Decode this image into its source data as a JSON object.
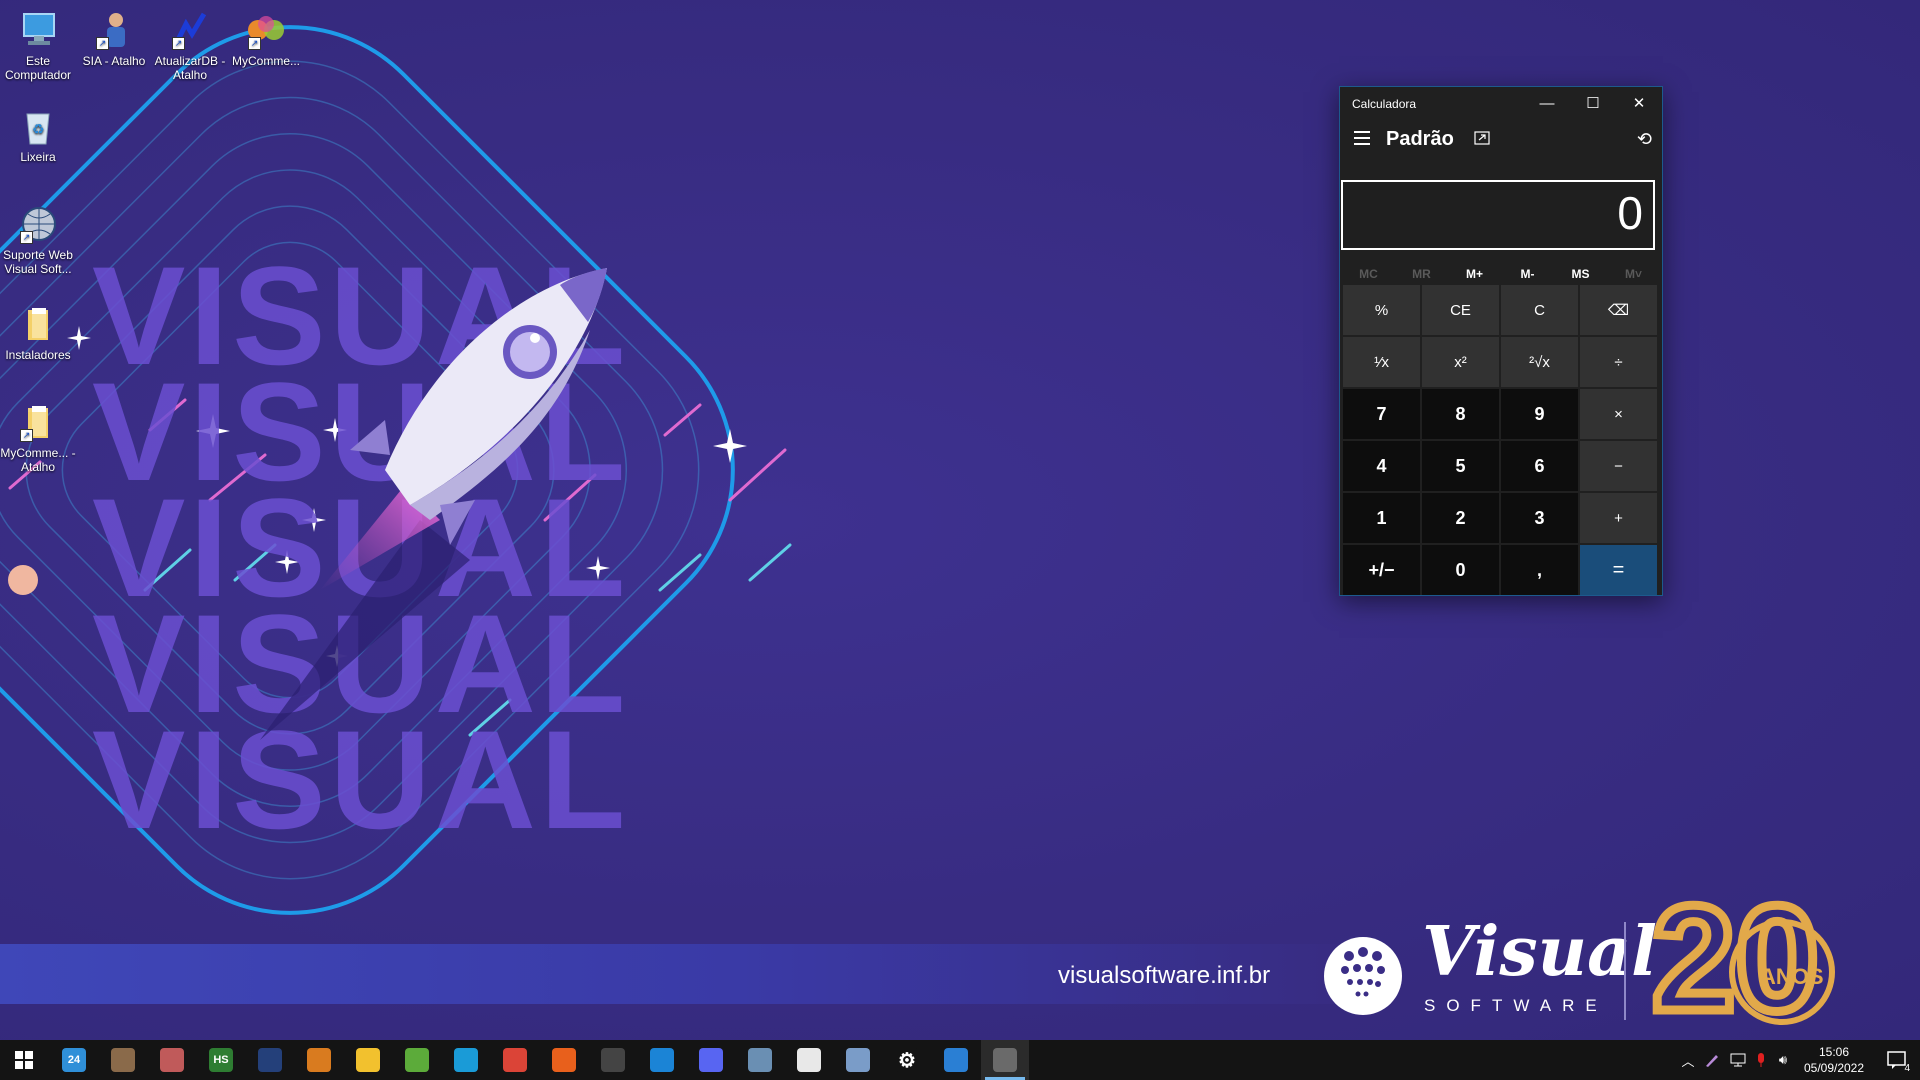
{
  "desktop": {
    "icons": [
      {
        "label": "Este Computador",
        "icon": "computer-icon"
      },
      {
        "label": "SIA - Atalho",
        "icon": "user-shortcut-icon"
      },
      {
        "label": "AtualizarDB - Atalho",
        "icon": "database-update-icon"
      },
      {
        "label": "MyComme...",
        "icon": "mycommerce-icon"
      },
      {
        "label": "Lixeira",
        "icon": "recycle-bin-icon"
      },
      {
        "label": "Suporte Web Visual Soft...",
        "icon": "globe-icon"
      },
      {
        "label": "Instaladores",
        "icon": "folder-icon"
      },
      {
        "label": "MyComme... - Atalho",
        "icon": "folder-shortcut-icon"
      }
    ],
    "wallpaper": {
      "word": "VISUAL",
      "url": "visualsoftware.inf.br",
      "brand_name": "Visual",
      "brand_sub": "SOFTWARE",
      "anniversary_number": "20",
      "anniversary_word": "ANOS"
    }
  },
  "calculator": {
    "title": "Calculadora",
    "mode": "Padrão",
    "display": "0",
    "memory_buttons": [
      {
        "label": "MC",
        "enabled": false
      },
      {
        "label": "MR",
        "enabled": false
      },
      {
        "label": "M+",
        "enabled": true
      },
      {
        "label": "M-",
        "enabled": true
      },
      {
        "label": "MS",
        "enabled": true
      },
      {
        "label": "M˅",
        "enabled": false
      }
    ],
    "keys": [
      {
        "label": "%",
        "type": "op",
        "name": "percent"
      },
      {
        "label": "CE",
        "type": "op",
        "name": "clear-entry"
      },
      {
        "label": "C",
        "type": "op",
        "name": "clear"
      },
      {
        "label": "⌫",
        "type": "op",
        "name": "backspace"
      },
      {
        "label": "¹⁄x",
        "type": "op",
        "name": "reciprocal"
      },
      {
        "label": "x²",
        "type": "op",
        "name": "square"
      },
      {
        "label": "²√x",
        "type": "op",
        "name": "square-root"
      },
      {
        "label": "÷",
        "type": "op",
        "name": "divide"
      },
      {
        "label": "7",
        "type": "num",
        "name": "digit-7"
      },
      {
        "label": "8",
        "type": "num",
        "name": "digit-8"
      },
      {
        "label": "9",
        "type": "num",
        "name": "digit-9"
      },
      {
        "label": "×",
        "type": "op",
        "name": "multiply"
      },
      {
        "label": "4",
        "type": "num",
        "name": "digit-4"
      },
      {
        "label": "5",
        "type": "num",
        "name": "digit-5"
      },
      {
        "label": "6",
        "type": "num",
        "name": "digit-6"
      },
      {
        "label": "−",
        "type": "op",
        "name": "subtract"
      },
      {
        "label": "1",
        "type": "num",
        "name": "digit-1"
      },
      {
        "label": "2",
        "type": "num",
        "name": "digit-2"
      },
      {
        "label": "3",
        "type": "num",
        "name": "digit-3"
      },
      {
        "label": "+",
        "type": "op",
        "name": "add"
      },
      {
        "label": "+/−",
        "type": "num",
        "name": "negate"
      },
      {
        "label": "0",
        "type": "num",
        "name": "digit-0"
      },
      {
        "label": ",",
        "type": "num",
        "name": "decimal"
      },
      {
        "label": "=",
        "type": "eq",
        "name": "equals"
      }
    ]
  },
  "taskbar": {
    "apps": [
      {
        "icon": "clock-app-icon",
        "text": "24",
        "color": "#2f8fd8"
      },
      {
        "icon": "sia-user-icon",
        "text": "",
        "color": "#8a6a4a"
      },
      {
        "icon": "paint-app-icon",
        "text": "",
        "color": "#c05a5a"
      },
      {
        "icon": "hs-app-icon",
        "text": "HS",
        "color": "#2e7d32"
      },
      {
        "icon": "atualizardb-icon",
        "text": "",
        "color": "#24407a"
      },
      {
        "icon": "mycommerce-icon",
        "text": "",
        "color": "#d97b1f"
      },
      {
        "icon": "file-explorer-icon",
        "text": "",
        "color": "#f2c12e"
      },
      {
        "icon": "notepad-icon",
        "text": "",
        "color": "#5cab3a"
      },
      {
        "icon": "edge-browser-icon",
        "text": "",
        "color": "#1a9bd7"
      },
      {
        "icon": "chrome-browser-icon",
        "text": "",
        "color": "#db4437"
      },
      {
        "icon": "firefox-browser-icon",
        "text": "",
        "color": "#e8601c"
      },
      {
        "icon": "clapperboard-icon",
        "text": "",
        "color": "#444444"
      },
      {
        "icon": "vscode-icon",
        "text": "",
        "color": "#1b84d6"
      },
      {
        "icon": "discord-icon",
        "text": "",
        "color": "#5865f2"
      },
      {
        "icon": "remote-desktop-icon",
        "text": "",
        "color": "#6a8fb3"
      },
      {
        "icon": "git-app-icon",
        "text": "",
        "color": "#e8e8e8"
      },
      {
        "icon": "palette-app-icon",
        "text": "",
        "color": "#7a9cc8"
      },
      {
        "icon": "settings-gear-icon",
        "text": "",
        "color": "#141414"
      },
      {
        "icon": "photos-app-icon",
        "text": "",
        "color": "#2a7fd4"
      },
      {
        "icon": "calculator-app-icon",
        "text": "",
        "color": "#6a6a6a"
      }
    ],
    "clock_time": "15:06",
    "clock_date": "05/09/2022",
    "notification_count": "4"
  }
}
